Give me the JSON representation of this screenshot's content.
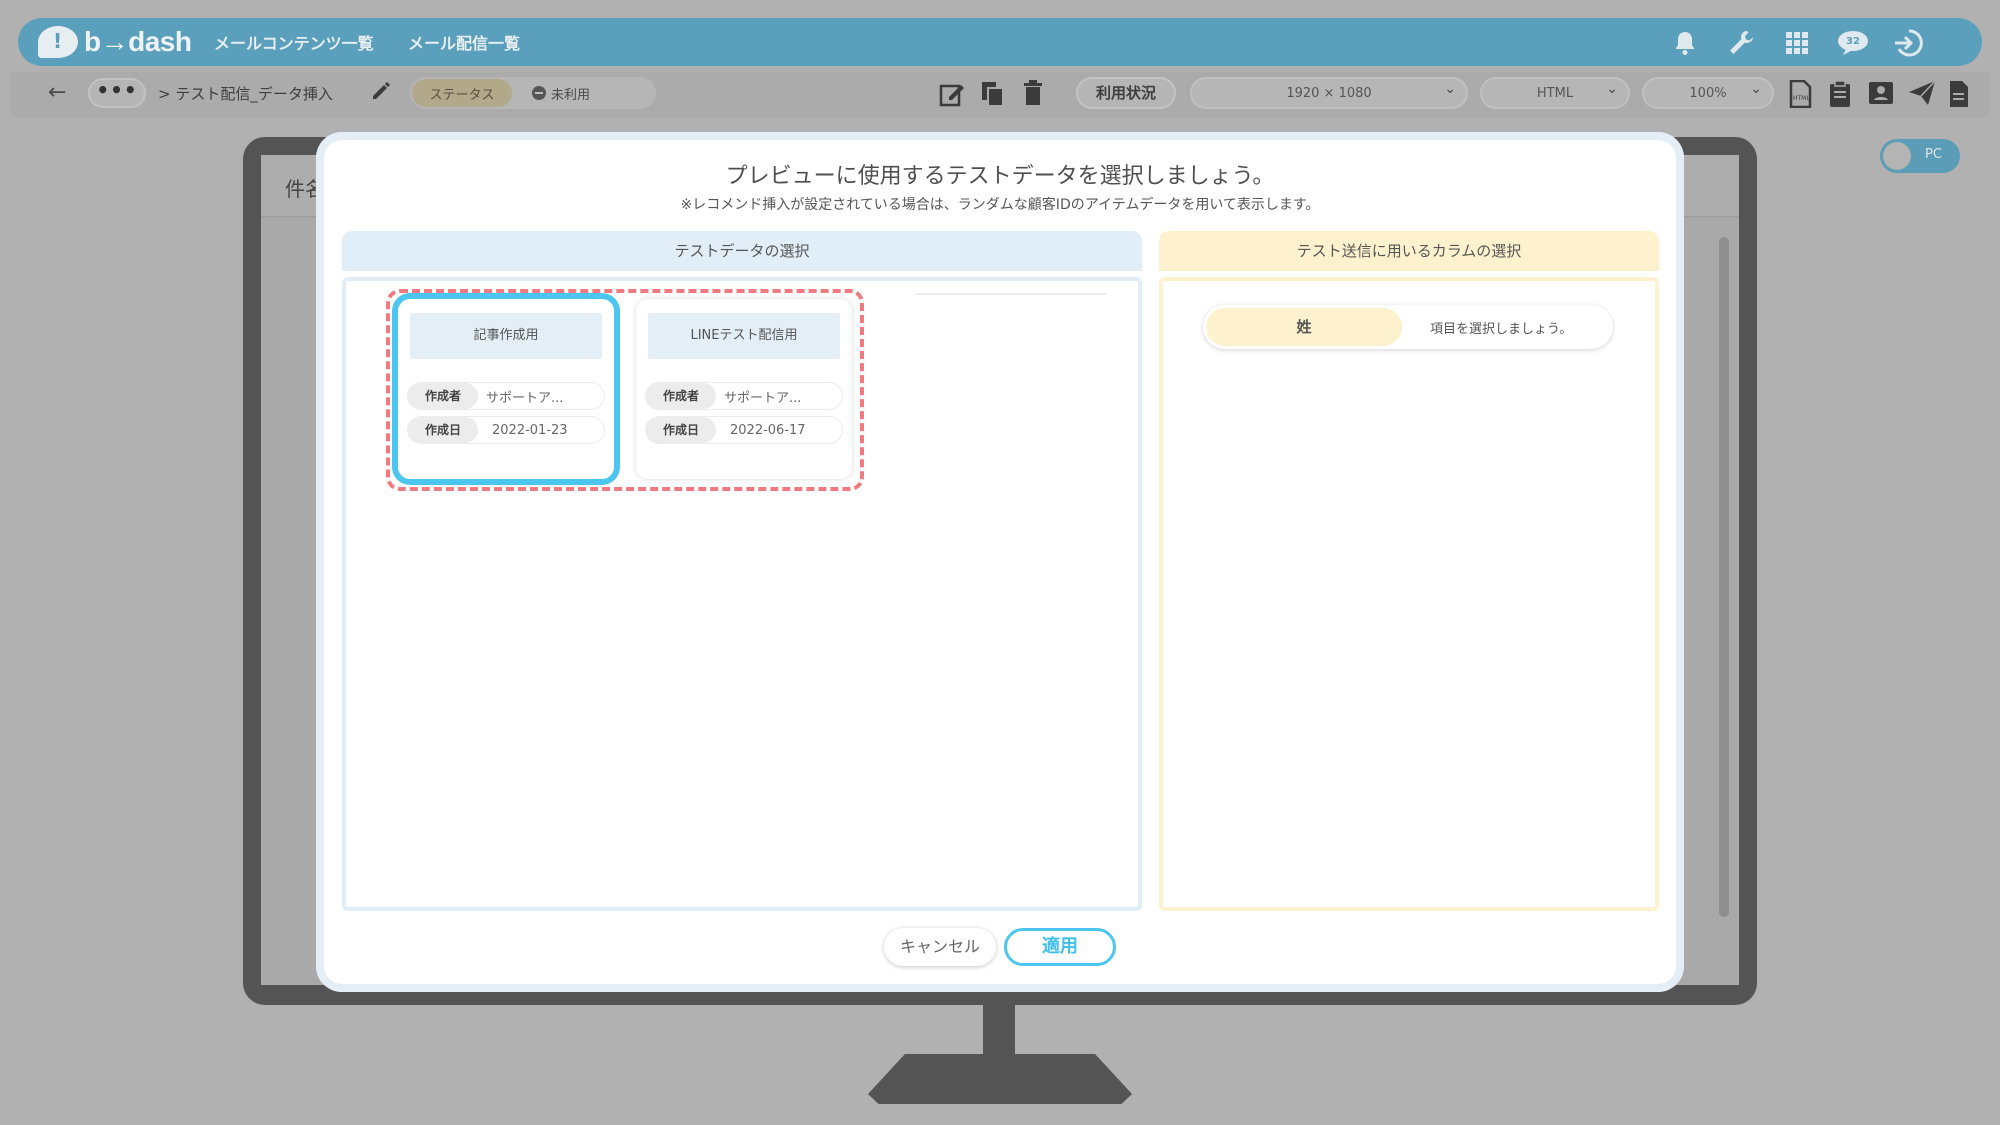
{
  "app": {
    "logo": "b→dash",
    "nav": [
      "メールコンテンツ一覧",
      "メール配信一覧"
    ],
    "notification_count": "32"
  },
  "toolbar": {
    "more": "•••",
    "breadcrumb": "> テスト配信_データ挿入",
    "status_label": "ステータス",
    "status_value": "未利用",
    "usage_button": "利用状況",
    "resolution": "1920 × 1080",
    "format": "HTML",
    "zoom": "100%"
  },
  "device_toggle": {
    "label": "PC"
  },
  "preview": {
    "subject_label": "件名"
  },
  "modal": {
    "title": "プレビューに使用するテストデータを選択しましょう。",
    "subtitle": "※レコメンド挿入が設定されている場合は、ランダムな顧客IDのアイテムデータを用いて表示します。",
    "left_header": "テストデータの選択",
    "right_header": "テスト送信に用いるカラムの選択",
    "cards": [
      {
        "title": "記事作成用",
        "author_label": "作成者",
        "author": "サポートア...",
        "date_label": "作成日",
        "date": "2022-01-23",
        "selected": true
      },
      {
        "title": "LINEテスト配信用",
        "author_label": "作成者",
        "author": "サポートア...",
        "date_label": "作成日",
        "date": "2022-06-17",
        "selected": false
      }
    ],
    "column_select": {
      "key": "姓",
      "placeholder": "項目を選択しましょう。"
    },
    "cancel": "キャンセル",
    "apply": "適用"
  },
  "colors": {
    "header": "#5a9fbb",
    "accent": "#4cc6ee",
    "dashed": "#f07a7f",
    "left_panel": "#e2eef7",
    "right_panel": "#fdf1ce"
  }
}
